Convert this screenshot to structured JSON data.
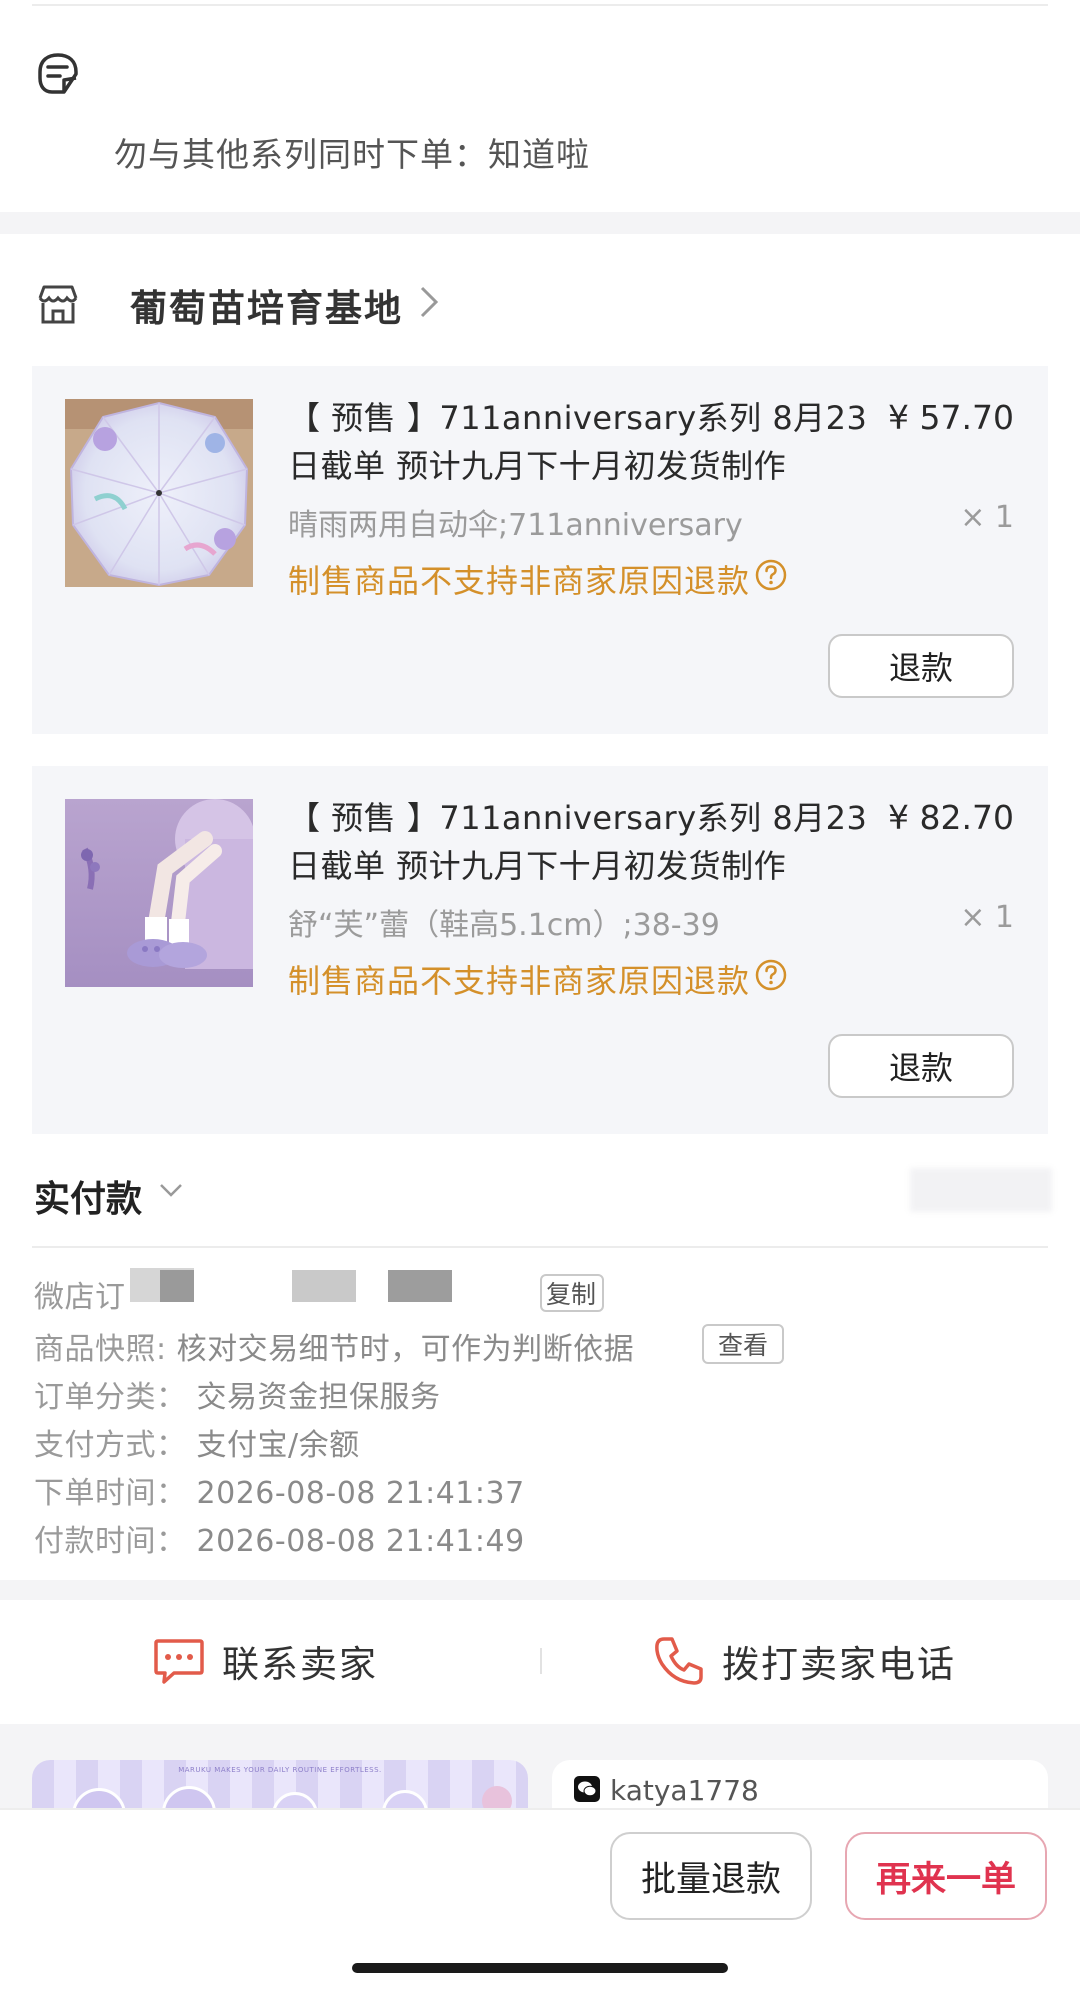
{
  "order_note": {
    "text": "勿与其他系列同时下单：知道啦",
    "icon": "note-icon"
  },
  "shop": {
    "name": "葡萄苗培育基地",
    "icon": "store-icon"
  },
  "products": [
    {
      "title": "【 预售 】711anniversary系列  8月23日截单  预计九月下十月初发货制作",
      "price": "¥ 57.70",
      "spec": "晴雨两用自动伞;711anniversary",
      "qty": "× 1",
      "warning": "制售商品不支持非商家原因退款",
      "refund_label": "退款",
      "image": "umbrella"
    },
    {
      "title": "【 预售 】711anniversary系列  8月23日截单  预计九月下十月初发货制作",
      "price": "¥ 82.70",
      "spec": "舒“芙”蕾（鞋高5.1cm）;38-39",
      "qty": "× 1",
      "warning": "制售商品不支持非商家原因退款",
      "refund_label": "退款",
      "image": "shoes"
    }
  ],
  "payment": {
    "label": "实付款"
  },
  "order_info": {
    "order_no_label": "微店订",
    "copy_label": "复制",
    "snapshot_label": "商品快照:",
    "snapshot_value": "核对交易细节时，可作为判断依据",
    "view_label": "查看",
    "category_label": "订单分类：",
    "category_value": "交易资金担保服务",
    "pay_method_label": "支付方式：",
    "pay_method_value": "支付宝/余额",
    "order_time_label": "下单时间：",
    "order_time_value": "2026-08-08 21:41:37",
    "pay_time_label": "付款时间：",
    "pay_time_value": "2026-08-08 21:41:49"
  },
  "contact": {
    "seller_label": "联系卖家",
    "phone_label": "拨打卖家电话"
  },
  "promo": {
    "banner_text": "MARUKU MAKES YOUR DAILY ROUTINE EFFORTLESS.",
    "wechat_id": "katya1778"
  },
  "bottom": {
    "batch_refund_label": "批量退款",
    "reorder_label": "再来一单"
  },
  "colors": {
    "warning": "#d4902a",
    "accent": "#e0334f",
    "card_bg": "#f5f6f9"
  }
}
